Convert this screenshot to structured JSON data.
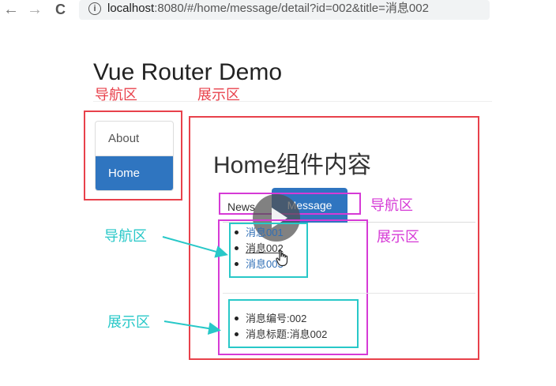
{
  "browser": {
    "back_icon": "←",
    "forward_icon": "→",
    "reload_icon": "C",
    "info_icon": "i",
    "url_host": "localhost",
    "url_rest": ":8080/#/home/message/detail?id=002&title=消息002"
  },
  "page": {
    "title": "Vue Router Demo"
  },
  "nav": {
    "items": [
      {
        "label": "About",
        "active": false
      },
      {
        "label": "Home",
        "active": true
      }
    ]
  },
  "home": {
    "heading": "Home组件内容",
    "tabs": [
      {
        "label": "News",
        "active": false
      },
      {
        "label": "Message",
        "active": true
      }
    ],
    "messages": [
      {
        "label": "消息001",
        "active": false
      },
      {
        "label": "消息002",
        "active": true
      },
      {
        "label": "消息003",
        "active": false
      }
    ],
    "detail": {
      "id_line": "消息编号:002",
      "title_line": "消息标题:消息002"
    }
  },
  "annotations": {
    "outer_nav_label": "导航区",
    "outer_view_label": "展示区",
    "inner_nav_label": "导航区",
    "inner_view_label": "展示区",
    "list_nav_label": "导航区",
    "list_view_label": "展示区",
    "colors": {
      "red": "#e8414b",
      "magenta": "#d63ad6",
      "cyan": "#28c8c8",
      "active_blue": "#2f75c0"
    }
  },
  "overlay": {
    "play_icon": "play-icon",
    "cursor_icon": "hand-pointer-icon"
  }
}
